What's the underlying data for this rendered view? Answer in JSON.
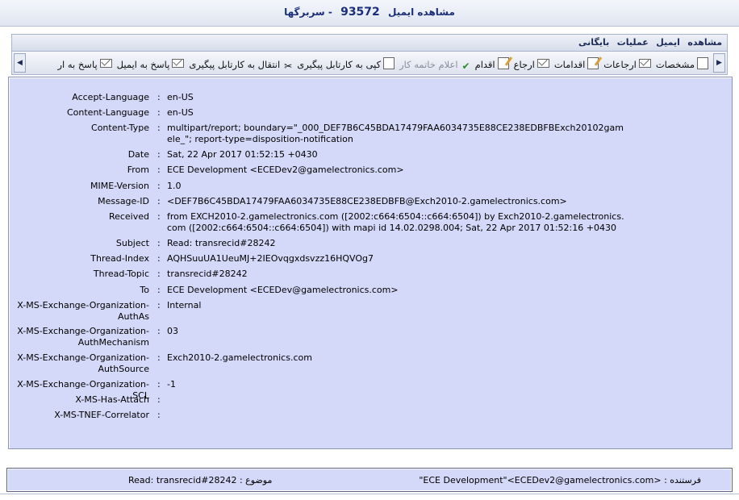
{
  "window": {
    "title_prefix": "مشاهده ایمیل",
    "title_number": "93572",
    "title_suffix": "- سربرگها"
  },
  "menu": {
    "items": [
      "مشاهده",
      "ایمیل",
      "عملیات",
      "بایگانی"
    ]
  },
  "toolbar": {
    "items": [
      {
        "label": "مشخصات",
        "icon": "document-icon",
        "enabled": true
      },
      {
        "label": "ارجاعات",
        "icon": "envelope-icon",
        "enabled": true
      },
      {
        "label": "اقدامات",
        "icon": "pen-icon",
        "enabled": true
      },
      {
        "label": "ارجاع",
        "icon": "envelope-icon",
        "enabled": true
      },
      {
        "label": "اقدام",
        "icon": "pen-icon",
        "enabled": true
      },
      {
        "label": "اعلام خاتمه کار",
        "icon": "checkmark-icon",
        "enabled": false
      },
      {
        "label": "کپی به کارتابل پیگیری",
        "icon": "document-icon",
        "enabled": true
      },
      {
        "label": "انتقال به کارتابل پیگیری",
        "icon": "scissors-icon",
        "enabled": true
      },
      {
        "label": "پاسخ به ایمیل",
        "icon": "envelope-icon",
        "enabled": true
      },
      {
        "label": "پاسخ به ار",
        "icon": "envelope-icon",
        "enabled": true
      }
    ]
  },
  "headers": [
    {
      "label": "Accept-Language",
      "value": "en-US"
    },
    {
      "label": "Content-Language",
      "value": "en-US"
    },
    {
      "label": "Content-Type",
      "value": "multipart/report; boundary=\"_000_DEF7B6C45BDA17479FAA6034735E88CE238EDBFBExch20102gamele_\"; report-type=disposition-notification"
    },
    {
      "label": "Date",
      "value": "Sat, 22 Apr 2017 01:52:15 +0430"
    },
    {
      "label": "From",
      "value": "ECE Development <ECEDev2@gamelectronics.com>"
    },
    {
      "label": "MIME-Version",
      "value": "1.0"
    },
    {
      "label": "Message-ID",
      "value": "<DEF7B6C45BDA17479FAA6034735E88CE238EDBFB@Exch2010-2.gamelectronics.com>"
    },
    {
      "label": "Received",
      "value": "from EXCH2010-2.gamelectronics.com ([2002:c664:6504::c664:6504]) by Exch2010-2.gamelectronics.com ([2002:c664:6504::c664:6504]) with mapi id 14.02.0298.004; Sat, 22 Apr 2017 01:52:16 +0430"
    },
    {
      "label": "Subject",
      "value": "Read: transrecid#28242"
    },
    {
      "label": "Thread-Index",
      "value": "AQHSuuUA1UeuMJ+2IEOvqgxdsvzz16HQVOg7"
    },
    {
      "label": "Thread-Topic",
      "value": "transrecid#28242"
    },
    {
      "label": "To",
      "value": "ECE Development <ECEDev@gamelectronics.com>"
    },
    {
      "label": "X-MS-Exchange-Organization-AuthAs",
      "value": "Internal"
    },
    {
      "label": "X-MS-Exchange-Organization-AuthMechanism",
      "value": "03"
    },
    {
      "label": "X-MS-Exchange-Organization-AuthSource",
      "value": "Exch2010-2.gamelectronics.com"
    },
    {
      "label": "X-MS-Exchange-Organization-SCL",
      "value": "-1"
    },
    {
      "label": "X-MS-Has-Attach",
      "value": ""
    },
    {
      "label": "X-MS-TNEF-Correlator",
      "value": ""
    }
  ],
  "separator": ":",
  "status": {
    "sender_label": "فرستنده :",
    "sender_value": "\"ECE Development\"<ECEDev2@gamelectronics.com>",
    "subject_label": "موضوع :",
    "subject_value": "Read: transrecid#28242"
  }
}
